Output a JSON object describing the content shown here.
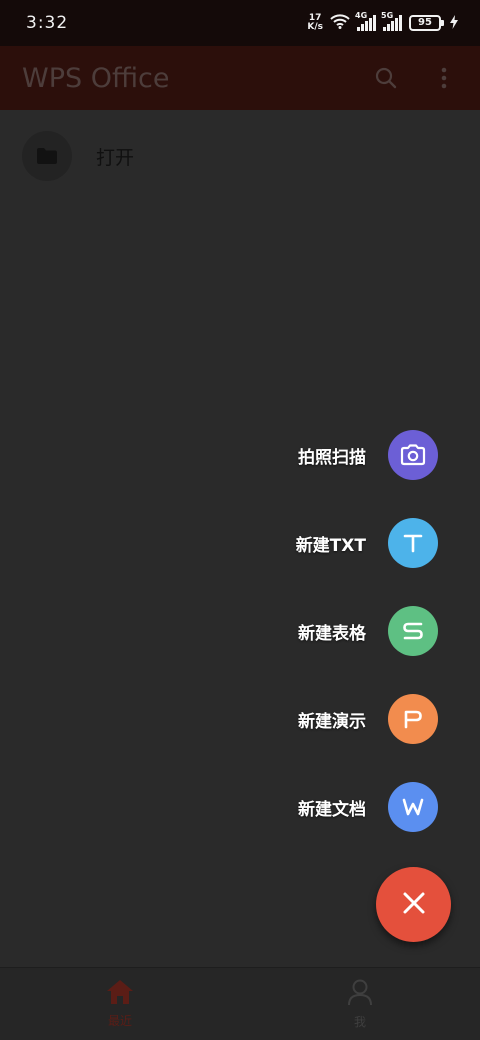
{
  "status_bar": {
    "time": "3:32",
    "net_speed_value": "17",
    "net_speed_unit": "K/s",
    "signal1_label": "4G",
    "signal2_label": "5G",
    "battery_level": "95"
  },
  "app_bar": {
    "title": "WPS Office",
    "search_icon": "search-icon",
    "menu_icon": "more-vert-icon"
  },
  "open_item": {
    "label": "打开",
    "icon": "folder-icon"
  },
  "fab_menu": {
    "items": [
      {
        "label": "拍照扫描",
        "icon": "camera-icon",
        "color": "#6c5fd6"
      },
      {
        "label": "新建TXT",
        "icon": "letter-t-icon",
        "color": "#4db3ea"
      },
      {
        "label": "新建表格",
        "icon": "letter-s-icon",
        "color": "#5ec083"
      },
      {
        "label": "新建演示",
        "icon": "letter-p-icon",
        "color": "#f28c4e"
      },
      {
        "label": "新建文档",
        "icon": "letter-w-icon",
        "color": "#5b8ff0"
      }
    ],
    "close_icon": "close-icon",
    "close_color": "#e4503c"
  },
  "bottom_nav": {
    "tabs": [
      {
        "label": "最近",
        "icon": "home-icon",
        "active": true,
        "color": "#5b1d16"
      },
      {
        "label": "我",
        "icon": "person-icon",
        "active": false,
        "color": "#3f3f3f"
      }
    ]
  },
  "colors": {
    "status_bar_bg": "#140a09",
    "app_bar_bg": "#2c0f0b",
    "overlay_bg": "#2a2a2a"
  }
}
